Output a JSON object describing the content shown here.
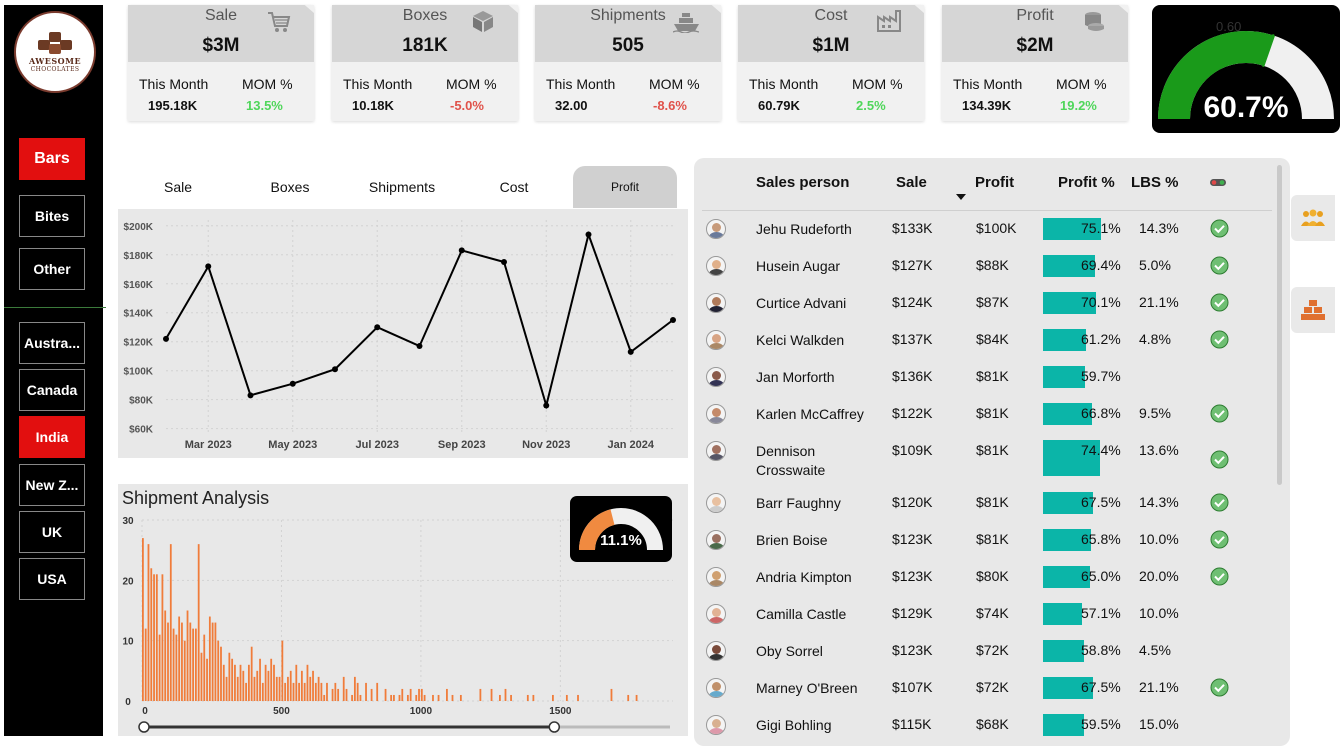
{
  "logo": {
    "line1": "AWESOME",
    "line2": "CHOCOLATES"
  },
  "sidebar": {
    "categories": [
      {
        "label": "Bars",
        "active": true
      },
      {
        "label": "Bites",
        "active": false
      },
      {
        "label": "Other",
        "active": false
      }
    ],
    "countries": [
      {
        "label": "Austra...",
        "active": false
      },
      {
        "label": "Canada",
        "active": false
      },
      {
        "label": "India",
        "active": true
      },
      {
        "label": "New Z...",
        "active": false
      },
      {
        "label": "UK",
        "active": false
      },
      {
        "label": "USA",
        "active": false
      }
    ]
  },
  "kpis": [
    {
      "title": "Sale",
      "value": "$3M",
      "icon": "cart-icon",
      "this_month_label": "This Month",
      "this_month": "195.18K",
      "mom_label": "MOM %",
      "mom": "13.5%",
      "mom_status": "positive"
    },
    {
      "title": "Boxes",
      "value": "181K",
      "icon": "box-icon",
      "this_month_label": "This Month",
      "this_month": "10.18K",
      "mom_label": "MOM %",
      "mom": "-5.0%",
      "mom_status": "negative"
    },
    {
      "title": "Shipments",
      "value": "505",
      "icon": "ship-icon",
      "this_month_label": "This Month",
      "this_month": "32.00",
      "mom_label": "MOM %",
      "mom": "-8.6%",
      "mom_status": "negative"
    },
    {
      "title": "Cost",
      "value": "$1M",
      "icon": "factory-icon",
      "this_month_label": "This Month",
      "this_month": "60.79K",
      "mom_label": "MOM %",
      "mom": "2.5%",
      "mom_status": "positive"
    },
    {
      "title": "Profit",
      "value": "$2M",
      "icon": "coins-icon",
      "this_month_label": "This Month",
      "this_month": "134.39K",
      "mom_label": "MOM %",
      "mom": "19.2%",
      "mom_status": "positive"
    }
  ],
  "profit_gauge": {
    "target_label": "0.60",
    "value_label": "60.7%",
    "value": 0.607,
    "target": 0.6,
    "fill_color": "#1a9a1a",
    "track_color": "#f0f0f0"
  },
  "tabs": [
    {
      "label": "Sale",
      "active": false
    },
    {
      "label": "Boxes",
      "active": false
    },
    {
      "label": "Shipments",
      "active": false
    },
    {
      "label": "Cost",
      "active": false
    },
    {
      "label": "Profit",
      "active": true
    }
  ],
  "shipment_analysis": {
    "title": "Shipment Analysis",
    "gauge": {
      "value_label": "11.1%",
      "value": 0.111,
      "fill_color": "#f08a40",
      "track_color": "#f0f0f0"
    },
    "slider": {
      "min_fraction": 0,
      "max_fraction": 0.78
    }
  },
  "chart_data": [
    {
      "type": "line",
      "title": "",
      "x": [
        "Feb 2023",
        "Mar 2023",
        "Apr 2023",
        "May 2023",
        "Jun 2023",
        "Jul 2023",
        "Aug 2023",
        "Sep 2023",
        "Oct 2023",
        "Nov 2023",
        "Dec 2023",
        "Jan 2024",
        "Feb 2024"
      ],
      "x_tick_labels": [
        "Mar 2023",
        "May 2023",
        "Jul 2023",
        "Sep 2023",
        "Nov 2023",
        "Jan 2024"
      ],
      "y_tick_labels": [
        "$60K",
        "$80K",
        "$100K",
        "$120K",
        "$140K",
        "$160K",
        "$180K",
        "$200K"
      ],
      "series": [
        {
          "values": [
            122000,
            172000,
            83000,
            91000,
            101000,
            130000,
            117000,
            183000,
            175000,
            76000,
            194000,
            113000,
            135000
          ]
        }
      ],
      "ylim": [
        57000,
        204000
      ],
      "grid": true
    },
    {
      "type": "bar",
      "title": "Shipment Analysis",
      "x_tick_labels": [
        "0",
        "500",
        "1000",
        "1500"
      ],
      "y_tick_labels": [
        "0",
        "10",
        "20",
        "30"
      ],
      "xlim": [
        0,
        1850
      ],
      "ylim": [
        0,
        30
      ],
      "bin_width": 10,
      "bins": [
        {
          "x": 0,
          "y": 27
        },
        {
          "x": 10,
          "y": 12
        },
        {
          "x": 20,
          "y": 26
        },
        {
          "x": 30,
          "y": 22
        },
        {
          "x": 40,
          "y": 21
        },
        {
          "x": 50,
          "y": 21
        },
        {
          "x": 60,
          "y": 11
        },
        {
          "x": 70,
          "y": 21
        },
        {
          "x": 80,
          "y": 15
        },
        {
          "x": 90,
          "y": 13
        },
        {
          "x": 100,
          "y": 26
        },
        {
          "x": 110,
          "y": 12
        },
        {
          "x": 120,
          "y": 11
        },
        {
          "x": 130,
          "y": 14
        },
        {
          "x": 140,
          "y": 13
        },
        {
          "x": 150,
          "y": 10
        },
        {
          "x": 160,
          "y": 15
        },
        {
          "x": 170,
          "y": 13
        },
        {
          "x": 180,
          "y": 12
        },
        {
          "x": 190,
          "y": 12
        },
        {
          "x": 200,
          "y": 26
        },
        {
          "x": 210,
          "y": 8
        },
        {
          "x": 220,
          "y": 11
        },
        {
          "x": 230,
          "y": 7
        },
        {
          "x": 240,
          "y": 14
        },
        {
          "x": 250,
          "y": 13
        },
        {
          "x": 260,
          "y": 13
        },
        {
          "x": 270,
          "y": 10
        },
        {
          "x": 280,
          "y": 9
        },
        {
          "x": 290,
          "y": 6
        },
        {
          "x": 300,
          "y": 4
        },
        {
          "x": 310,
          "y": 8
        },
        {
          "x": 320,
          "y": 7
        },
        {
          "x": 330,
          "y": 6
        },
        {
          "x": 340,
          "y": 4
        },
        {
          "x": 350,
          "y": 6
        },
        {
          "x": 360,
          "y": 5
        },
        {
          "x": 370,
          "y": 3
        },
        {
          "x": 380,
          "y": 6
        },
        {
          "x": 390,
          "y": 9
        },
        {
          "x": 400,
          "y": 4
        },
        {
          "x": 410,
          "y": 5
        },
        {
          "x": 420,
          "y": 7
        },
        {
          "x": 430,
          "y": 3
        },
        {
          "x": 440,
          "y": 6
        },
        {
          "x": 450,
          "y": 5
        },
        {
          "x": 460,
          "y": 7
        },
        {
          "x": 470,
          "y": 6
        },
        {
          "x": 480,
          "y": 4
        },
        {
          "x": 490,
          "y": 4
        },
        {
          "x": 500,
          "y": 10
        },
        {
          "x": 510,
          "y": 3
        },
        {
          "x": 520,
          "y": 4
        },
        {
          "x": 530,
          "y": 5
        },
        {
          "x": 540,
          "y": 3
        },
        {
          "x": 550,
          "y": 6
        },
        {
          "x": 560,
          "y": 3
        },
        {
          "x": 570,
          "y": 5
        },
        {
          "x": 580,
          "y": 3
        },
        {
          "x": 590,
          "y": 6
        },
        {
          "x": 600,
          "y": 4
        },
        {
          "x": 610,
          "y": 5
        },
        {
          "x": 620,
          "y": 3
        },
        {
          "x": 630,
          "y": 4
        },
        {
          "x": 640,
          "y": 3
        },
        {
          "x": 650,
          "y": 1
        },
        {
          "x": 660,
          "y": 3
        },
        {
          "x": 680,
          "y": 2
        },
        {
          "x": 690,
          "y": 3
        },
        {
          "x": 700,
          "y": 2
        },
        {
          "x": 720,
          "y": 4
        },
        {
          "x": 730,
          "y": 2
        },
        {
          "x": 750,
          "y": 1
        },
        {
          "x": 760,
          "y": 4
        },
        {
          "x": 770,
          "y": 3
        },
        {
          "x": 780,
          "y": 1
        },
        {
          "x": 800,
          "y": 3
        },
        {
          "x": 820,
          "y": 2
        },
        {
          "x": 840,
          "y": 3
        },
        {
          "x": 870,
          "y": 2
        },
        {
          "x": 890,
          "y": 1
        },
        {
          "x": 900,
          "y": 1
        },
        {
          "x": 920,
          "y": 1
        },
        {
          "x": 930,
          "y": 2
        },
        {
          "x": 950,
          "y": 1
        },
        {
          "x": 960,
          "y": 2
        },
        {
          "x": 980,
          "y": 1
        },
        {
          "x": 990,
          "y": 2
        },
        {
          "x": 1000,
          "y": 2
        },
        {
          "x": 1010,
          "y": 1
        },
        {
          "x": 1040,
          "y": 1
        },
        {
          "x": 1060,
          "y": 1
        },
        {
          "x": 1090,
          "y": 2
        },
        {
          "x": 1110,
          "y": 1
        },
        {
          "x": 1140,
          "y": 1
        },
        {
          "x": 1210,
          "y": 2
        },
        {
          "x": 1250,
          "y": 2
        },
        {
          "x": 1280,
          "y": 1
        },
        {
          "x": 1300,
          "y": 2
        },
        {
          "x": 1320,
          "y": 1
        },
        {
          "x": 1380,
          "y": 1
        },
        {
          "x": 1400,
          "y": 1
        },
        {
          "x": 1470,
          "y": 1
        },
        {
          "x": 1520,
          "y": 1
        },
        {
          "x": 1560,
          "y": 1
        },
        {
          "x": 1680,
          "y": 2
        },
        {
          "x": 1740,
          "y": 1
        },
        {
          "x": 1770,
          "y": 1
        }
      ]
    }
  ],
  "table": {
    "headers": {
      "person": "Sales person",
      "sale": "Sale",
      "profit": "Profit",
      "profit_pct": "Profit %",
      "lbs_pct": "LBS %"
    },
    "sort_column": "profit",
    "bar_color": "#0bb5a8",
    "rows": [
      {
        "name": "Jehu Rudeforth",
        "sale": "$133K",
        "profit": "$100K",
        "profit_pct": "75.1%",
        "profit_pct_value": 0.751,
        "lbs": "14.3%",
        "check": true
      },
      {
        "name": "Husein Augar",
        "sale": "$127K",
        "profit": "$88K",
        "profit_pct": "69.4%",
        "profit_pct_value": 0.694,
        "lbs": "5.0%",
        "check": true
      },
      {
        "name": "Curtice Advani",
        "sale": "$124K",
        "profit": "$87K",
        "profit_pct": "70.1%",
        "profit_pct_value": 0.701,
        "lbs": "21.1%",
        "check": true
      },
      {
        "name": "Kelci Walkden",
        "sale": "$137K",
        "profit": "$84K",
        "profit_pct": "61.2%",
        "profit_pct_value": 0.612,
        "lbs": "4.8%",
        "check": true
      },
      {
        "name": "Jan Morforth",
        "sale": "$136K",
        "profit": "$81K",
        "profit_pct": "59.7%",
        "profit_pct_value": 0.597,
        "lbs": "",
        "check": false
      },
      {
        "name": "Karlen McCaffrey",
        "sale": "$122K",
        "profit": "$81K",
        "profit_pct": "66.8%",
        "profit_pct_value": 0.668,
        "lbs": "9.5%",
        "check": true
      },
      {
        "name": "Dennison Crosswaite",
        "sale": "$109K",
        "profit": "$81K",
        "profit_pct": "74.4%",
        "profit_pct_value": 0.744,
        "lbs": "13.6%",
        "check": true,
        "tall": true
      },
      {
        "name": "Barr Faughny",
        "sale": "$120K",
        "profit": "$81K",
        "profit_pct": "67.5%",
        "profit_pct_value": 0.675,
        "lbs": "14.3%",
        "check": true
      },
      {
        "name": "Brien Boise",
        "sale": "$123K",
        "profit": "$81K",
        "profit_pct": "65.8%",
        "profit_pct_value": 0.658,
        "lbs": "10.0%",
        "check": true
      },
      {
        "name": "Andria Kimpton",
        "sale": "$123K",
        "profit": "$80K",
        "profit_pct": "65.0%",
        "profit_pct_value": 0.65,
        "lbs": "20.0%",
        "check": true
      },
      {
        "name": "Camilla Castle",
        "sale": "$129K",
        "profit": "$74K",
        "profit_pct": "57.1%",
        "profit_pct_value": 0.571,
        "lbs": "10.0%",
        "check": false
      },
      {
        "name": "Oby Sorrel",
        "sale": "$123K",
        "profit": "$72K",
        "profit_pct": "58.8%",
        "profit_pct_value": 0.588,
        "lbs": "4.5%",
        "check": false
      },
      {
        "name": "Marney O'Breen",
        "sale": "$107K",
        "profit": "$72K",
        "profit_pct": "67.5%",
        "profit_pct_value": 0.675,
        "lbs": "21.1%",
        "check": true
      },
      {
        "name": "Gigi Bohling",
        "sale": "$115K",
        "profit": "$68K",
        "profit_pct": "59.5%",
        "profit_pct_value": 0.595,
        "lbs": "15.0%",
        "check": false
      }
    ]
  },
  "side_buttons": [
    {
      "icon": "people-icon"
    },
    {
      "icon": "boxes-icon"
    }
  ]
}
